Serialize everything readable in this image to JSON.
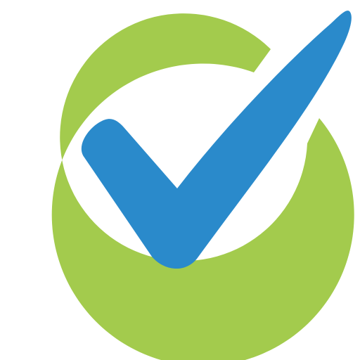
{
  "logo": {
    "ring": {
      "icon": "circle-ring",
      "color": "#a3cb4d"
    },
    "check": {
      "icon": "checkmark",
      "color": "#2a8acb"
    },
    "background_color": "#ffffff"
  }
}
